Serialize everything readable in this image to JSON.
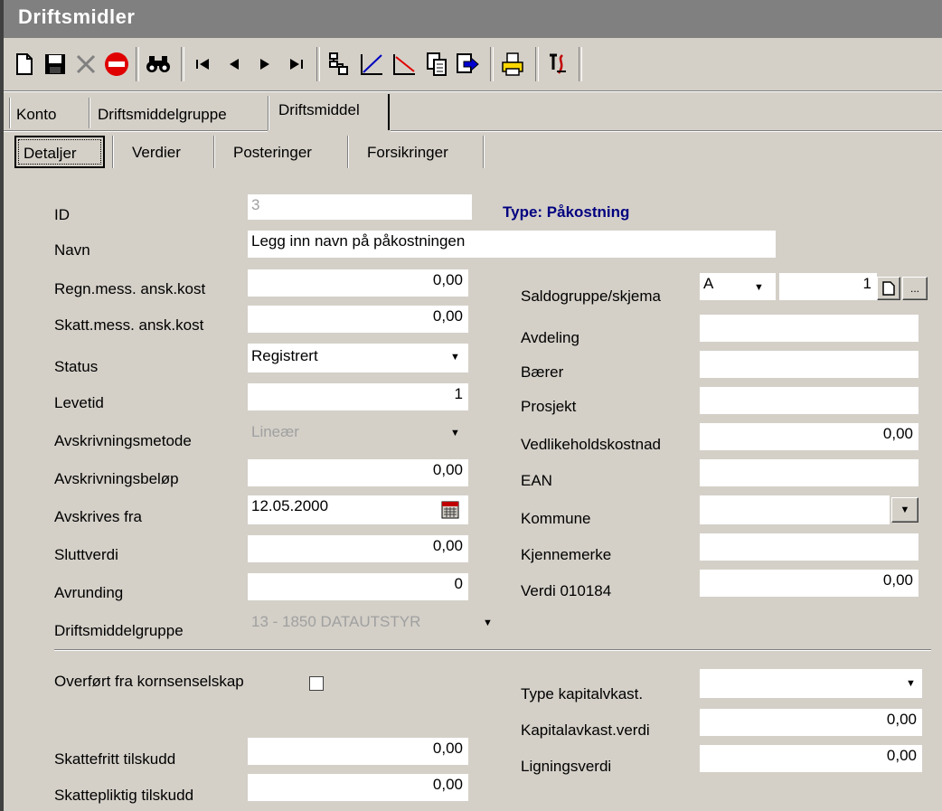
{
  "window": {
    "title": "Driftsmidler"
  },
  "toolbar": {
    "icons": [
      "new-document-icon",
      "save-icon",
      "delete-icon",
      "stop-icon",
      "find-icon",
      "first-record-icon",
      "previous-record-icon",
      "next-record-icon",
      "last-record-icon",
      "add-component-icon",
      "appreciation-icon",
      "depreciation-icon",
      "copy-record-icon",
      "export-icon",
      "print-icon",
      "sort-icon"
    ]
  },
  "main_tabs": [
    {
      "label": "Konto",
      "active": false
    },
    {
      "label": "Driftsmiddelgruppe",
      "active": false
    },
    {
      "label": "Driftsmiddel",
      "active": true
    }
  ],
  "sub_tabs": [
    {
      "label": "Detaljer",
      "active": true
    },
    {
      "label": "Verdier",
      "active": false
    },
    {
      "label": "Posteringer",
      "active": false
    },
    {
      "label": "Forsikringer",
      "active": false
    }
  ],
  "form": {
    "id_label": "ID",
    "id_value": "3",
    "type_text": "Type: Påkostning",
    "navn_label": "Navn",
    "navn_value": "Legg inn navn på påkostningen",
    "regn_label": "Regn.mess. ansk.kost",
    "regn_value": "0,00",
    "skatt_label": "Skatt.mess. ansk.kost",
    "skatt_value": "0,00",
    "status_label": "Status",
    "status_value": "Registrert",
    "levetid_label": "Levetid",
    "levetid_value": "1",
    "metode_label": "Avskrivningsmetode",
    "metode_value": "Lineær",
    "belop_label": "Avskrivningsbeløp",
    "belop_value": "0,00",
    "fra_label": "Avskrives fra",
    "fra_value": "12.05.2000",
    "slutt_label": "Sluttverdi",
    "slutt_value": "0,00",
    "avrunding_label": "Avrunding",
    "avrunding_value": "0",
    "gruppe_label": "Driftsmiddelgruppe",
    "gruppe_value": "13 - 1850 DATAUTSTYR",
    "saldo_label": "Saldogruppe/skjema",
    "saldo_value": "A",
    "saldo_num": "1",
    "avdeling_label": "Avdeling",
    "avdeling_value": "",
    "baerer_label": "Bærer",
    "baerer_value": "",
    "prosjekt_label": "Prosjekt",
    "prosjekt_value": "",
    "vedlikehold_label": "Vedlikeholdskostnad",
    "vedlikehold_value": "0,00",
    "ean_label": "EAN",
    "ean_value": "",
    "kommune_label": "Kommune",
    "kommune_value": "",
    "kjennemerke_label": "Kjennemerke",
    "kjennemerke_value": "",
    "verdi_label": "Verdi 010184",
    "verdi_value": "0,00"
  },
  "bottom": {
    "overfort_label": "Overført fra kornsenselskap",
    "overfort_checked": false,
    "typekap_label": "Type kapitalvkast.",
    "typekap_value": "",
    "kapverdi_label": "Kapitalavkast.verdi",
    "kapverdi_value": "0,00",
    "ligning_label": "Ligningsverdi",
    "ligning_value": "0,00",
    "skattefritt_label": "Skattefritt tilskudd",
    "skattefritt_value": "0,00",
    "skattepliktig_label": "Skattepliktig tilskudd",
    "skattepliktig_value": "0,00"
  },
  "colors": {
    "title_bar": "#808080",
    "face": "#d4d0c8",
    "type_text": "#000080"
  }
}
